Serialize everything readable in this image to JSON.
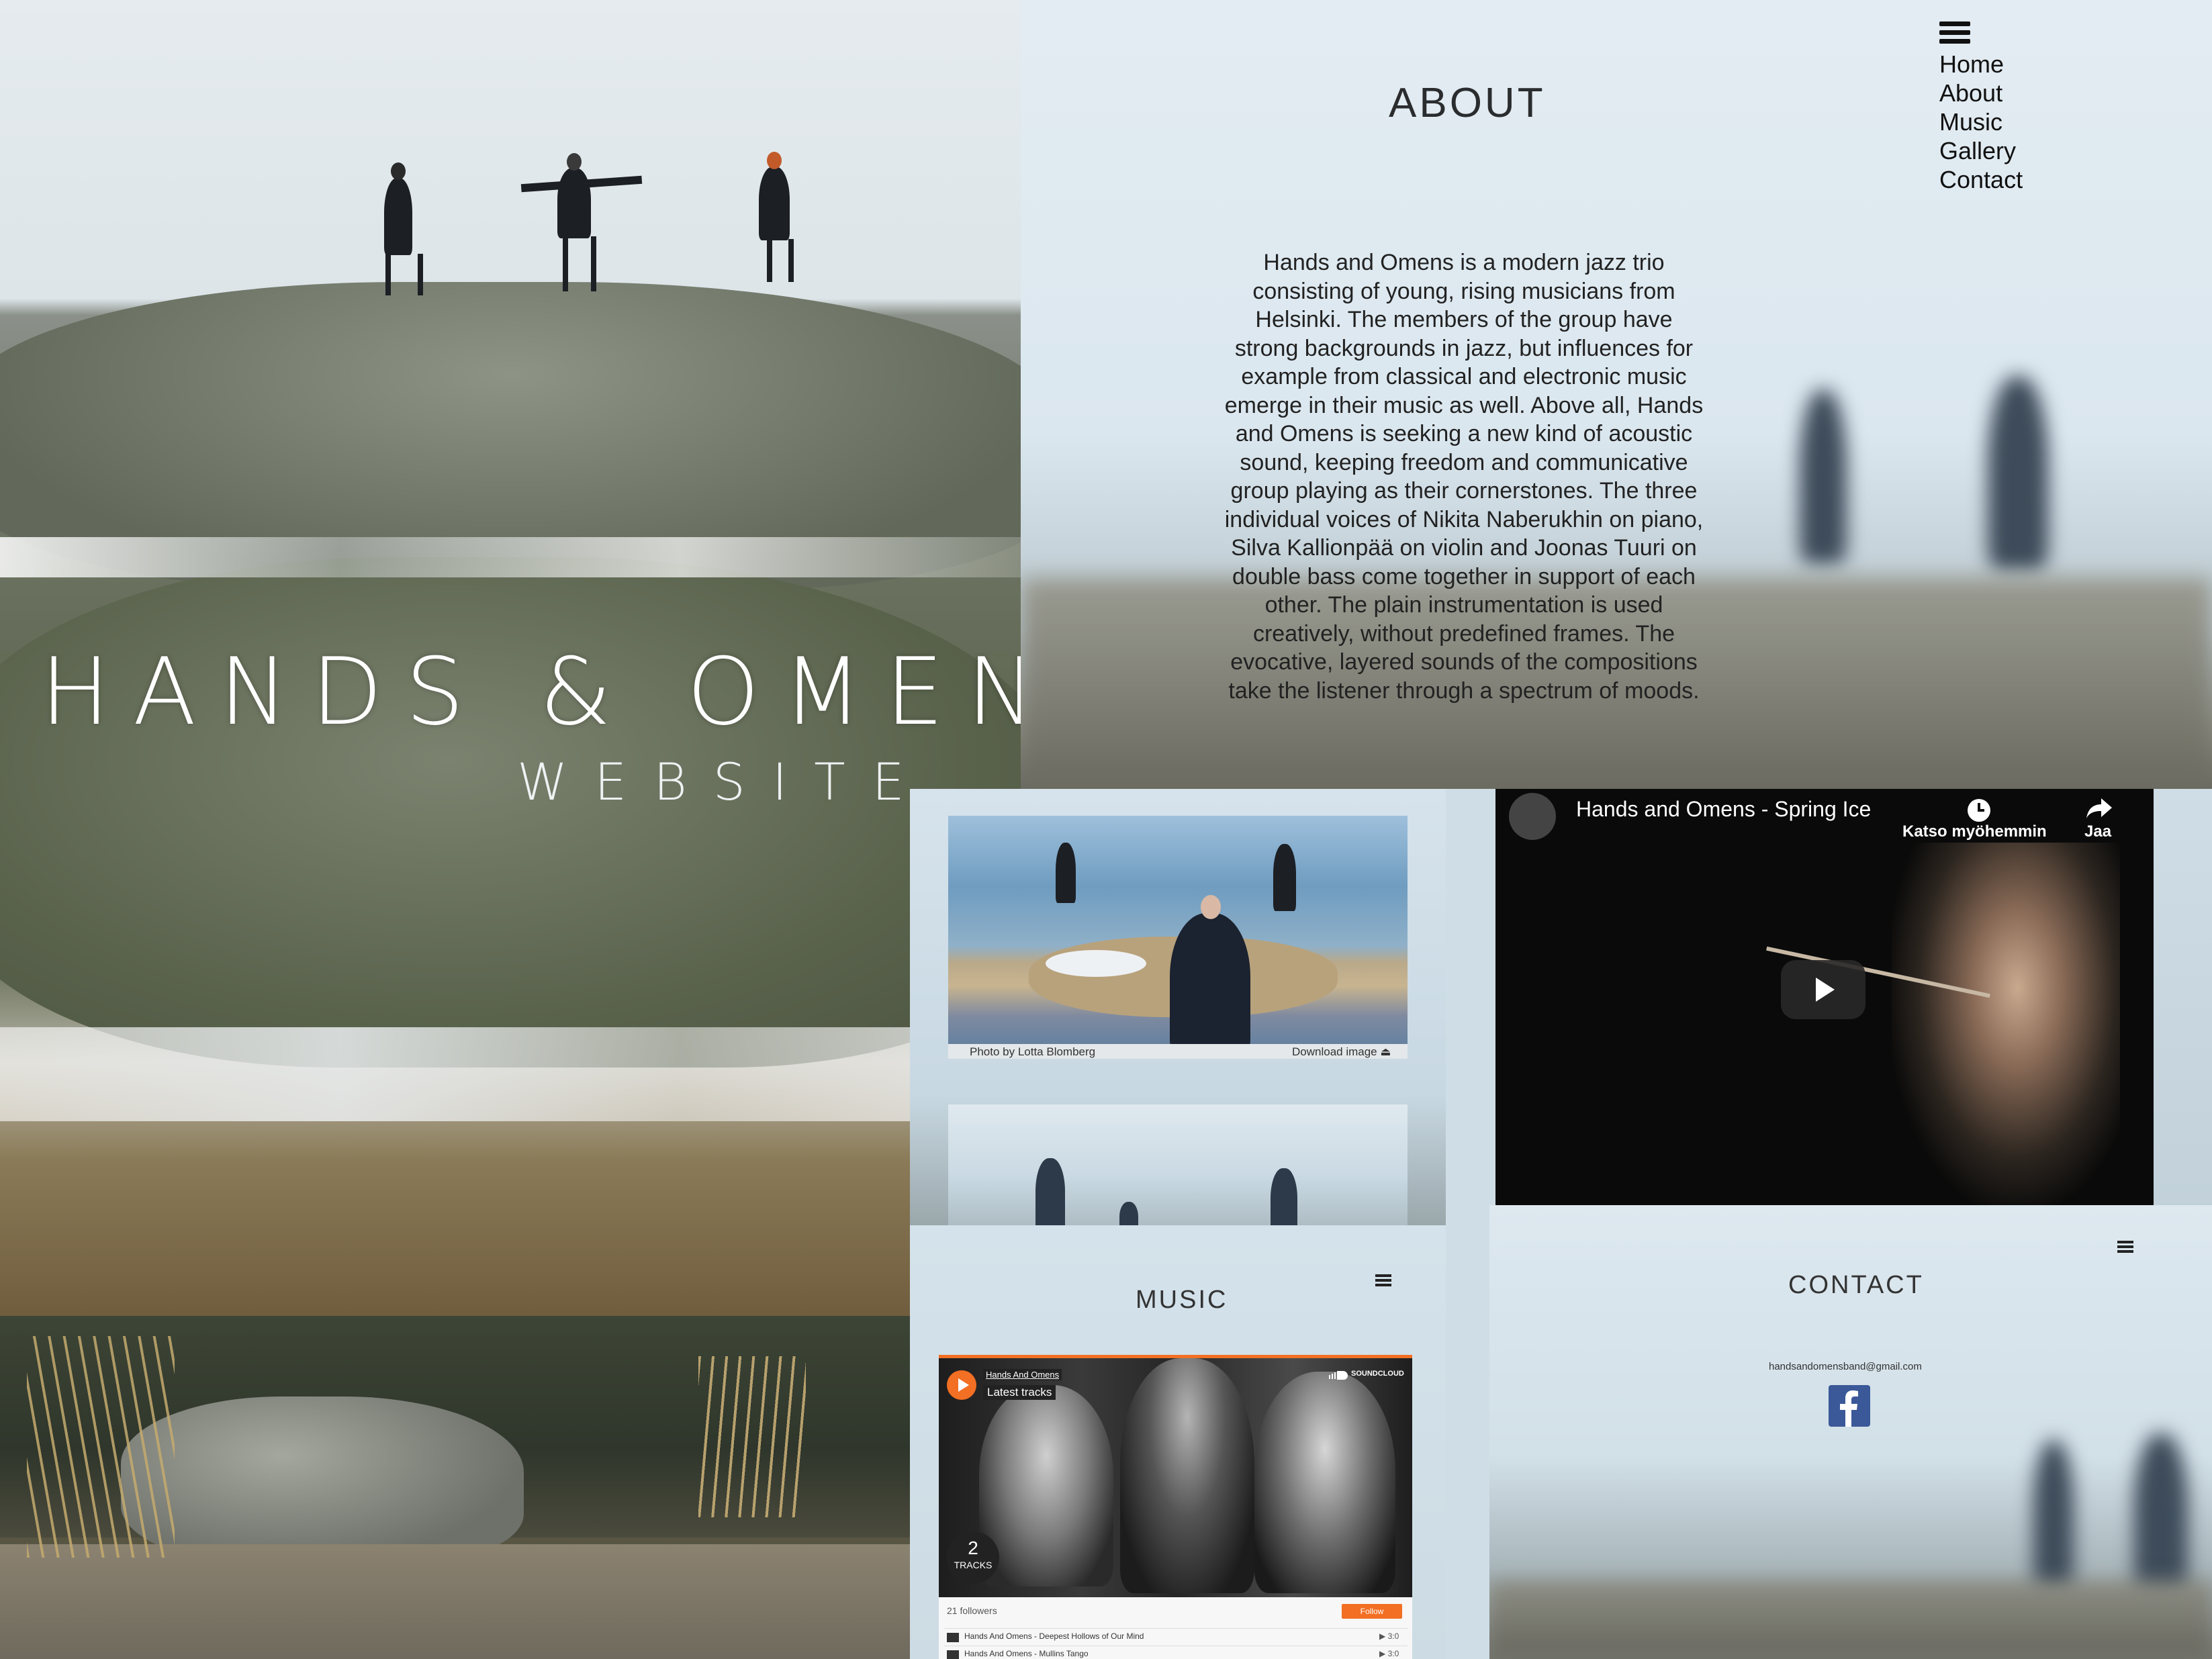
{
  "hero": {
    "title": "HANDS & OMENS",
    "subtitle": "WEBSITE"
  },
  "about": {
    "heading": "ABOUT",
    "nav": [
      "Home",
      "About",
      "Music",
      "Gallery",
      "Contact"
    ],
    "body": "Hands and Omens is a modern jazz trio consisting of young, rising musicians from Helsinki. The members of the group have strong backgrounds in jazz, but influences for example from classical and electronic music emerge in their music as well. Above all, Hands and Omens is seeking a new kind of acoustic sound, keeping freedom and communicative group playing as their cornerstones. The three individual voices of Nikita Naberukhin on piano, Silva Kallionpää on violin and Joonas Tuuri on double bass come together in support of each other. The plain instrumentation is used creatively, without predefined frames. The evocative, layered sounds of the compositions take the listener through a spectrum of moods."
  },
  "gallery": {
    "photo_credit": "Photo by Lotta Blomberg",
    "download_label": "Download image ⏏"
  },
  "video": {
    "title": "Hands and Omens - Spring Ice",
    "watch_later": "Katso myöhemmin",
    "share": "Jaa"
  },
  "music": {
    "heading": "MUSIC",
    "widget": {
      "artist": "Hands And Omens",
      "playlist_label": "Latest tracks",
      "brand": "SOUNDCLOUD",
      "track_count": "2",
      "tracks_label": "TRACKS",
      "followers": "21 followers",
      "follow_label": "Follow",
      "tracks": [
        {
          "title": "Hands And Omens - Deepest Hollows of Our Mind",
          "duration": "▶ 3:0"
        },
        {
          "title": "Hands And Omens - Mullins Tango",
          "duration": "▶ 3:0"
        }
      ]
    }
  },
  "contact": {
    "heading": "CONTACT",
    "email": "handsandomensband@gmail.com",
    "social_icon": "facebook-icon"
  },
  "colors": {
    "soundcloud_orange": "#f26f23",
    "facebook_blue": "#3b5998"
  }
}
